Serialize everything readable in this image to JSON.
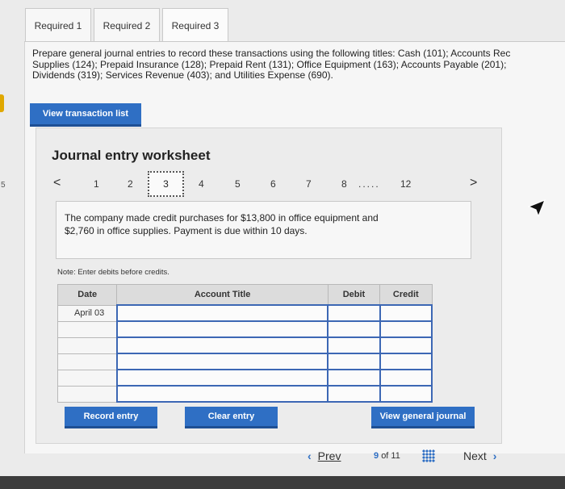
{
  "tabs": [
    {
      "label": "Required 1"
    },
    {
      "label": "Required 2"
    },
    {
      "label": "Required 3"
    }
  ],
  "instructions": {
    "line1": "Prepare general journal entries to record these transactions using the following titles: Cash (101); Accounts Rec",
    "line2": "Supplies (124); Prepaid Insurance (128); Prepaid Rent (131); Office Equipment (163); Accounts Payable (201);",
    "line3": "Dividends (319); Services Revenue (403); and Utilities Expense (690)."
  },
  "buttons": {
    "view_transactions": "View transaction list",
    "record_entry": "Record entry",
    "clear_entry": "Clear entry",
    "view_journal": "View general journal"
  },
  "worksheet": {
    "title": "Journal entry worksheet",
    "pager": {
      "prev": "<",
      "next": ">",
      "pages": [
        "1",
        "2",
        "3",
        "4",
        "5",
        "6",
        "7",
        "8"
      ],
      "ellipsis": ".....",
      "last": "12",
      "selected": "3"
    },
    "description_line1": "The company made credit purchases for $13,800 in office equipment and",
    "description_line2": "$2,760 in office supplies. Payment is due within 10 days.",
    "note": "Note: Enter debits before credits.",
    "table": {
      "headers": {
        "date": "Date",
        "account": "Account Title",
        "debit": "Debit",
        "credit": "Credit"
      },
      "rows": [
        {
          "date": "April 03",
          "account": "",
          "debit": "",
          "credit": ""
        },
        {
          "date": "",
          "account": "",
          "debit": "",
          "credit": ""
        },
        {
          "date": "",
          "account": "",
          "debit": "",
          "credit": ""
        },
        {
          "date": "",
          "account": "",
          "debit": "",
          "credit": ""
        },
        {
          "date": "",
          "account": "",
          "debit": "",
          "credit": ""
        },
        {
          "date": "",
          "account": "",
          "debit": "",
          "credit": ""
        }
      ]
    }
  },
  "footer_nav": {
    "prev": "Prev",
    "page_current": "9",
    "page_of": "of 11",
    "next": "Next"
  },
  "colors": {
    "accent": "#2f6fc4",
    "input_border": "#3c67b4"
  }
}
